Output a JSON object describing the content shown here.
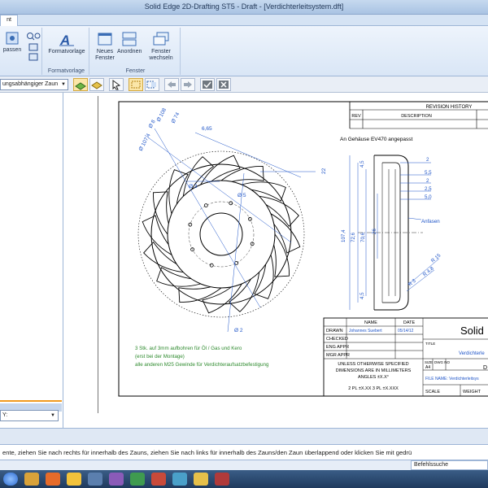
{
  "window": {
    "title": "Solid Edge 2D-Drafting ST5 - Draft - [Verdichterleitsystem.dft]"
  },
  "ribbon": {
    "tab_label": "nt",
    "groups": [
      {
        "name": "anpassen",
        "button_label": "passen"
      },
      {
        "name": "formatvorlage",
        "button_label": "Formatvorlage",
        "group_label": "Formatvorlage"
      },
      {
        "name": "fenster",
        "buttons": [
          "Neues Fenster",
          "Anordnen",
          "Fenster wechseln"
        ],
        "group_label": "Fenster"
      }
    ]
  },
  "toolbar": {
    "zone_select_value": "ungsabhängiger Zaun"
  },
  "left_panel": {
    "dropdown_value": "Y:"
  },
  "drawing": {
    "revision_header": "REVISION HISTORY",
    "rev_col": "REV",
    "desc_col": "DESCRIPTION",
    "note_top": "An Gehäuse EV470 angepasst",
    "note_bottom_1": "3 Stk. auf 3mm aufbohren für Öl / Gas und Kero",
    "note_bottom_2": "(erst bei der Montage)",
    "note_bottom_3": "alle anderen M25 Gewinde für Verdichteraufsatzbefestigung",
    "label_anfasen_1": "Anfasen",
    "label_anfasen_2": "Anfasen",
    "dims": {
      "d_phi8": "Ø 8",
      "d_phi108": "Ø 108",
      "d_phi107": "Ø 107,4",
      "d_phi74": "Ø 74",
      "d_665": "6,65",
      "d_phi3": "Ø 3",
      "d_phi5": "Ø 5",
      "d_phi2": "Ø 2",
      "d_22": "22",
      "d_2a": "2",
      "d_55": "5,5",
      "d_2b": "2",
      "d_25": "2,5",
      "d_50": "5,0",
      "d_45a": "4,5",
      "d_45b": "4,5",
      "d_1074": "107,4",
      "d_726": "72,6",
      "d_706": "70,6",
      "d_26": "26",
      "d_r15": "R 15",
      "d_r3": "R 3",
      "d_r48": "R 4,8"
    },
    "titleblock": {
      "name_hdr": "NAME",
      "date_hdr": "DATE",
      "drawn": "DRAWN",
      "drawn_name": "Johannes Suebert",
      "drawn_date": "05/14/12",
      "checked": "CHECKED",
      "eng_appr": "ENG APPR",
      "mgr_appr": "MGR APPR",
      "unless_1": "UNLESS OTHERWISE SPECIFIED",
      "unless_2": "DIMENSIONS ARE IN MILLIMETERS",
      "unless_3": "ANGLES ±X.X°",
      "unless_4": "2 PL ±X.XX 3 PL ±X.XXX",
      "company": "Solid",
      "title_lbl": "TITLE",
      "title_val": "Verdichterle",
      "size_lbl": "SIZE",
      "size_val": "A4",
      "dwg_lbl": "DWG NO",
      "dwg_val": "D",
      "file_name": "FILE NAME: Verdichterleitsys",
      "scale": "SCALE",
      "weight": "WEIGHT"
    }
  },
  "prompt": {
    "text": "ente, ziehen Sie nach rechts für innerhalb des Zauns, ziehen Sie nach links für innerhalb des Zauns/den Zaun überlappend oder klicken Sie mit gedrü"
  },
  "command_search": {
    "label": "Befehlssuche"
  },
  "colors": {
    "accent": "#f19a1f",
    "dim_blue": "#1f55c8",
    "note_green": "#2d8a2d"
  }
}
